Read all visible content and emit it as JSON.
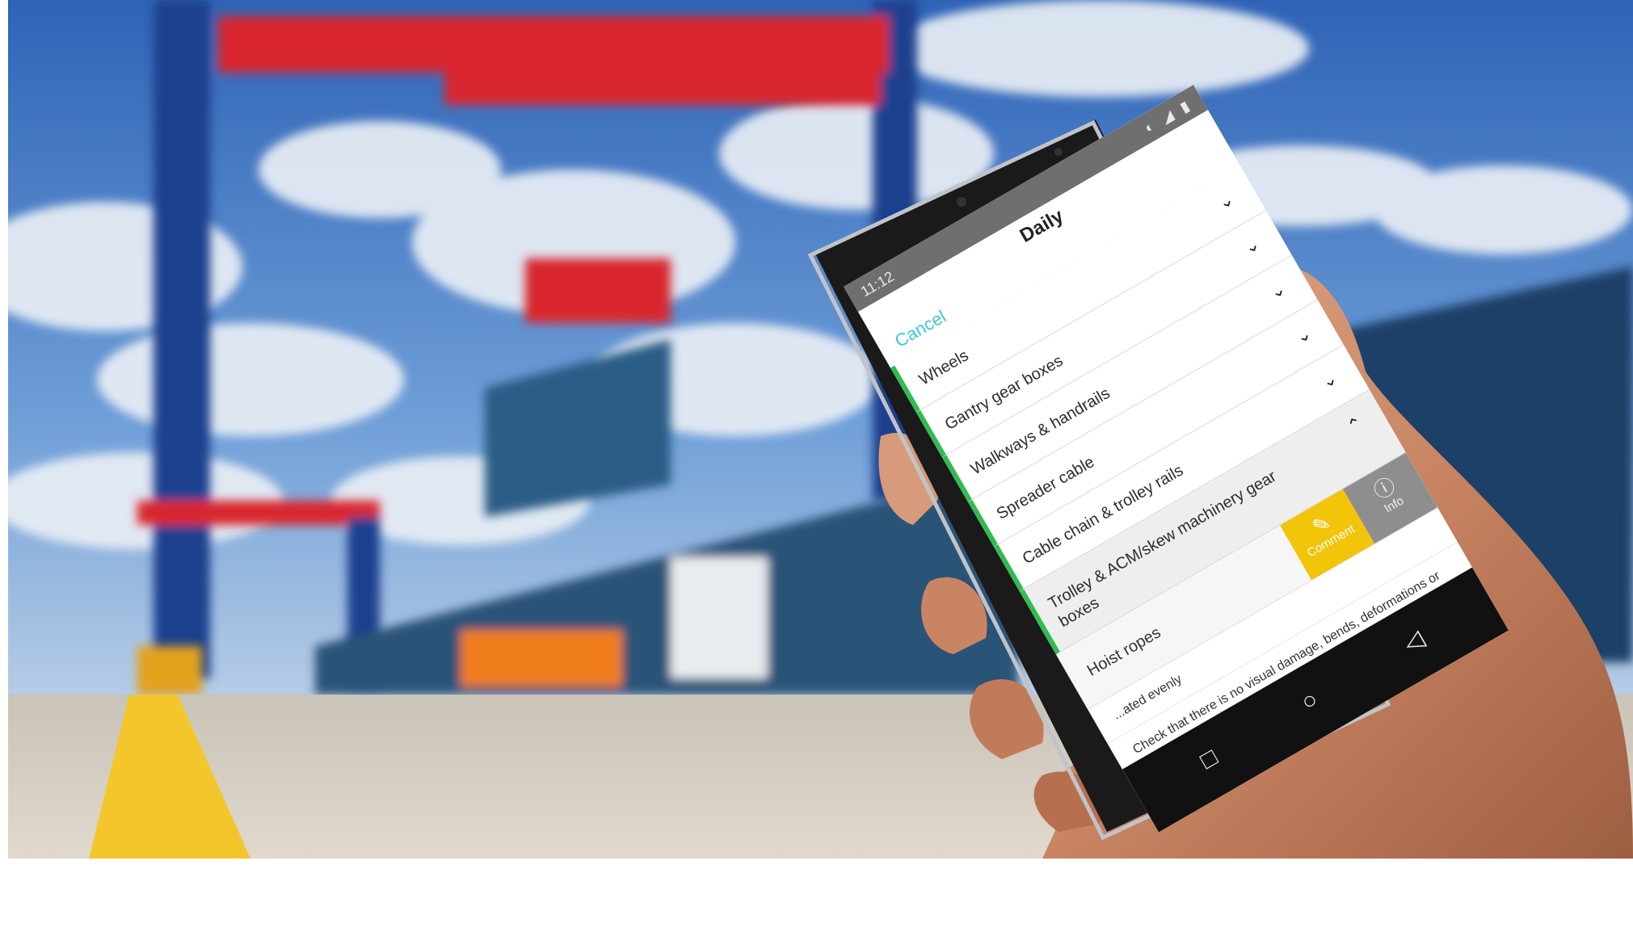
{
  "app": {
    "status_time": "11:12",
    "status_icons": "◐ ◢ ▮",
    "cancel_label": "Cancel",
    "title": "Daily"
  },
  "checklist": {
    "items": [
      {
        "label": "Wheels",
        "state": "collapsed"
      },
      {
        "label": "Gantry gear boxes",
        "state": "collapsed"
      },
      {
        "label": "Walkways & handrails",
        "state": "collapsed"
      },
      {
        "label": "Spreader cable",
        "state": "collapsed"
      },
      {
        "label": "Cable chain & trolley rails",
        "state": "collapsed"
      },
      {
        "label": "Trolley & ACM/skew machinery gear boxes",
        "state": "expanded"
      }
    ],
    "sub_item": {
      "label": "Hoist ropes",
      "comment_label": "Comment",
      "info_label": "Info"
    },
    "details": [
      "...ated evenly",
      "Check that there is no visual damage, bends, deformations or corrosion in ropes"
    ]
  },
  "icons": {
    "chevron_down": "⌄",
    "chevron_up": "⌃",
    "comment": "✎",
    "info": "ⓘ",
    "nav_back": "◁",
    "nav_home": "○",
    "nav_recent": "□"
  },
  "colors": {
    "accent_green": "#2fbd4f",
    "comment_yellow": "#f2c40a",
    "cancel_cyan": "#3fc6d6",
    "info_gray": "#8e8e8e"
  }
}
